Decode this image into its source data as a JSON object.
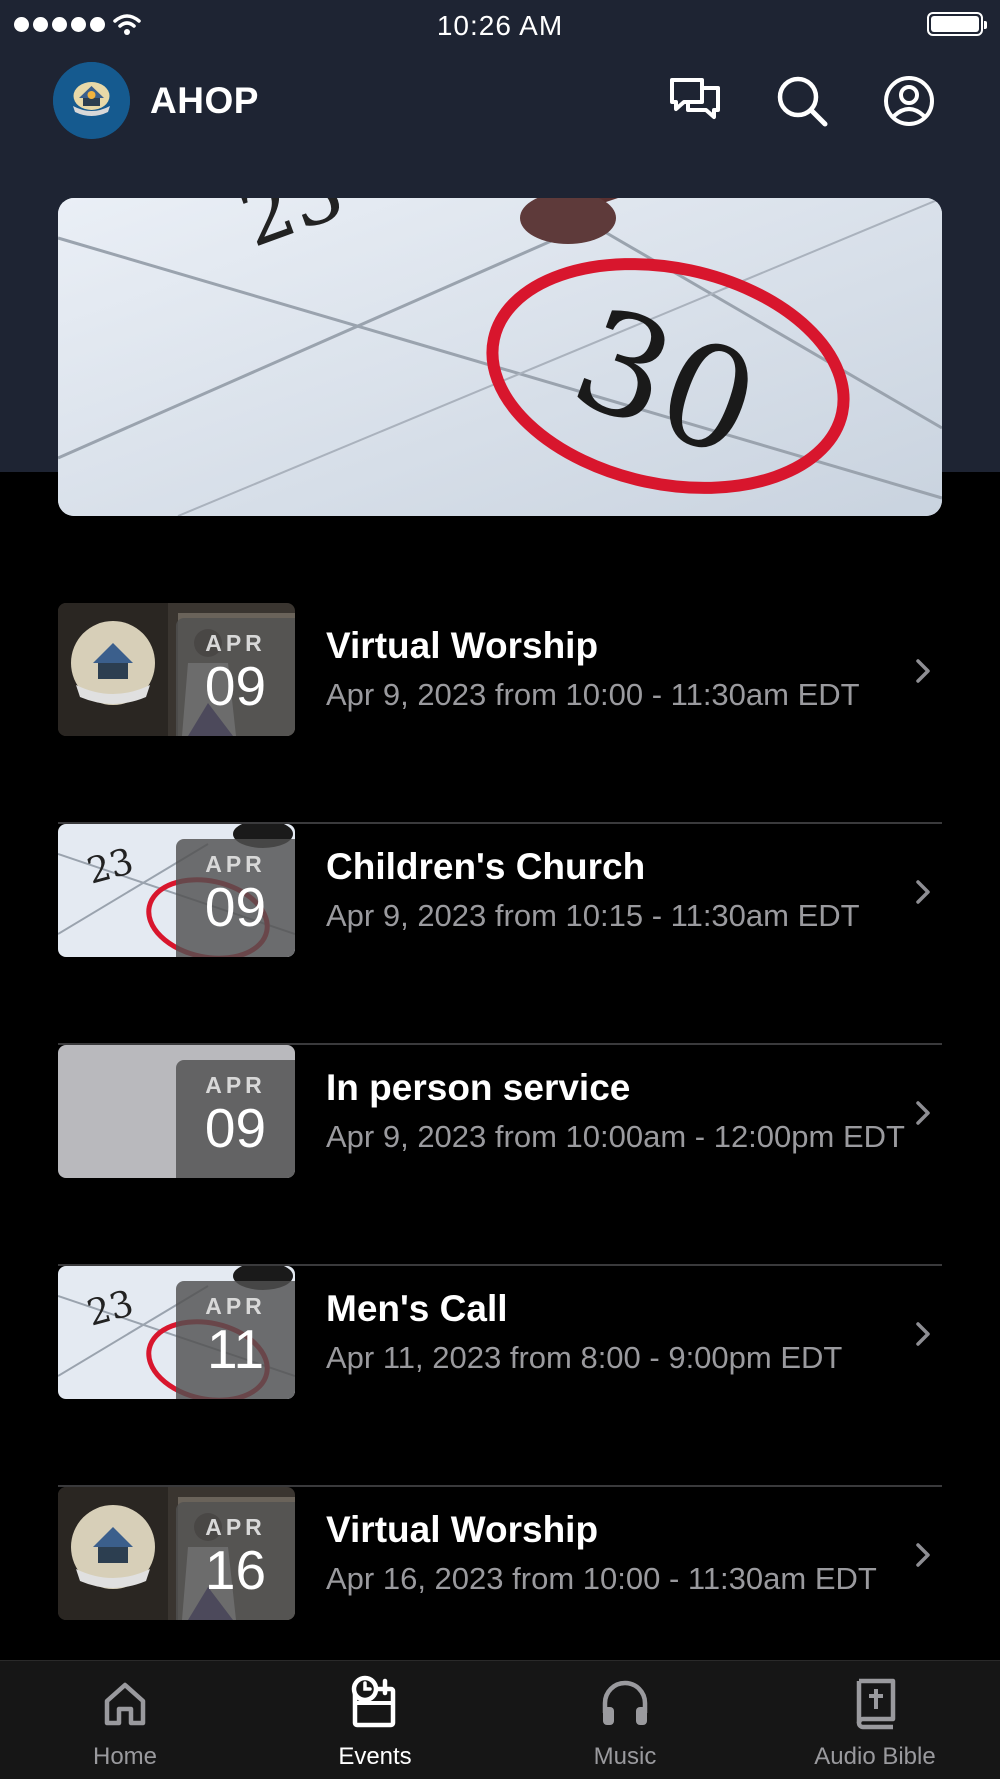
{
  "status_bar": {
    "time": "10:26 AM"
  },
  "header": {
    "title": "AHOP"
  },
  "events": [
    {
      "title": "Virtual Worship",
      "subtitle": "Apr 9, 2023 from 10:00 - 11:30am EDT",
      "month": "APR",
      "day": "09",
      "thumbnail": "worship-photo"
    },
    {
      "title": "Children's Church",
      "subtitle": "Apr 9, 2023 from 10:15 - 11:30am EDT",
      "month": "APR",
      "day": "09",
      "thumbnail": "calendar-photo"
    },
    {
      "title": "In person service",
      "subtitle": "Apr 9, 2023 from 10:00am - 12:00pm EDT",
      "month": "APR",
      "day": "09",
      "thumbnail": "blank-gray"
    },
    {
      "title": "Men's Call",
      "subtitle": "Apr 11, 2023 from 8:00 - 9:00pm EDT",
      "month": "APR",
      "day": "11",
      "thumbnail": "calendar-photo"
    },
    {
      "title": "Virtual Worship",
      "subtitle": "Apr 16, 2023 from 10:00 - 11:30am EDT",
      "month": "APR",
      "day": "16",
      "thumbnail": "worship-photo"
    }
  ],
  "tabs": [
    {
      "label": "Home",
      "icon": "home-icon",
      "active": false
    },
    {
      "label": "Events",
      "icon": "events-icon",
      "active": true
    },
    {
      "label": "Music",
      "icon": "headphones-icon",
      "active": false
    },
    {
      "label": "Audio Bible",
      "icon": "bible-icon",
      "active": false
    }
  ],
  "colors": {
    "header_bg": "#1e2433",
    "background": "#000000",
    "tab_bar": "#161616",
    "logo_bg": "#155a8f"
  }
}
